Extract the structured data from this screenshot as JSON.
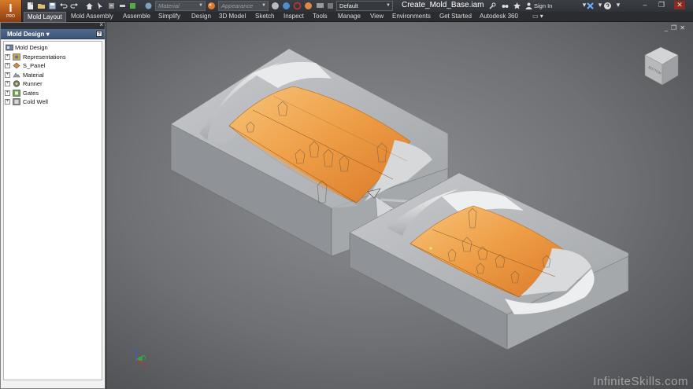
{
  "app": {
    "app_button": "I",
    "app_sub": "PRO",
    "document_title": "Create_Mold_Base.iam",
    "sign_in": "Sign In"
  },
  "quick_access": {
    "material_placeholder": "Material",
    "appearance_placeholder": "Appearance",
    "view_rep_value": "Default"
  },
  "tabs": [
    {
      "label": "Mold Layout",
      "active": true
    },
    {
      "label": "Mold Assembly"
    },
    {
      "label": "Assemble"
    },
    {
      "label": "Simplify"
    },
    {
      "label": "Design"
    },
    {
      "label": "3D Model"
    },
    {
      "label": "Sketch"
    },
    {
      "label": "Inspect"
    },
    {
      "label": "Tools"
    },
    {
      "label": "Manage"
    },
    {
      "label": "View"
    },
    {
      "label": "Environments"
    },
    {
      "label": "Get Started"
    },
    {
      "label": "Autodesk 360"
    }
  ],
  "browser": {
    "title": "Mold Design",
    "help": "?",
    "root": "Mold Design",
    "nodes": [
      {
        "label": "Representations",
        "icon": "representations-icon"
      },
      {
        "label": "S_Panel",
        "icon": "part-icon"
      },
      {
        "label": "Material",
        "icon": "material-icon"
      },
      {
        "label": "Runner",
        "icon": "runner-icon"
      },
      {
        "label": "Gates",
        "icon": "gates-icon"
      },
      {
        "label": "Cold Well",
        "icon": "cold-well-icon"
      }
    ]
  },
  "viewcube": {
    "face_label": "BOTTOM"
  },
  "watermark": "InfiniteSkills.com",
  "colors": {
    "app_orange": "#c9601e",
    "part_surface": "#f2b05a",
    "mold_gray": "#b9bbbe",
    "selected_tab": "#4a4d53"
  }
}
